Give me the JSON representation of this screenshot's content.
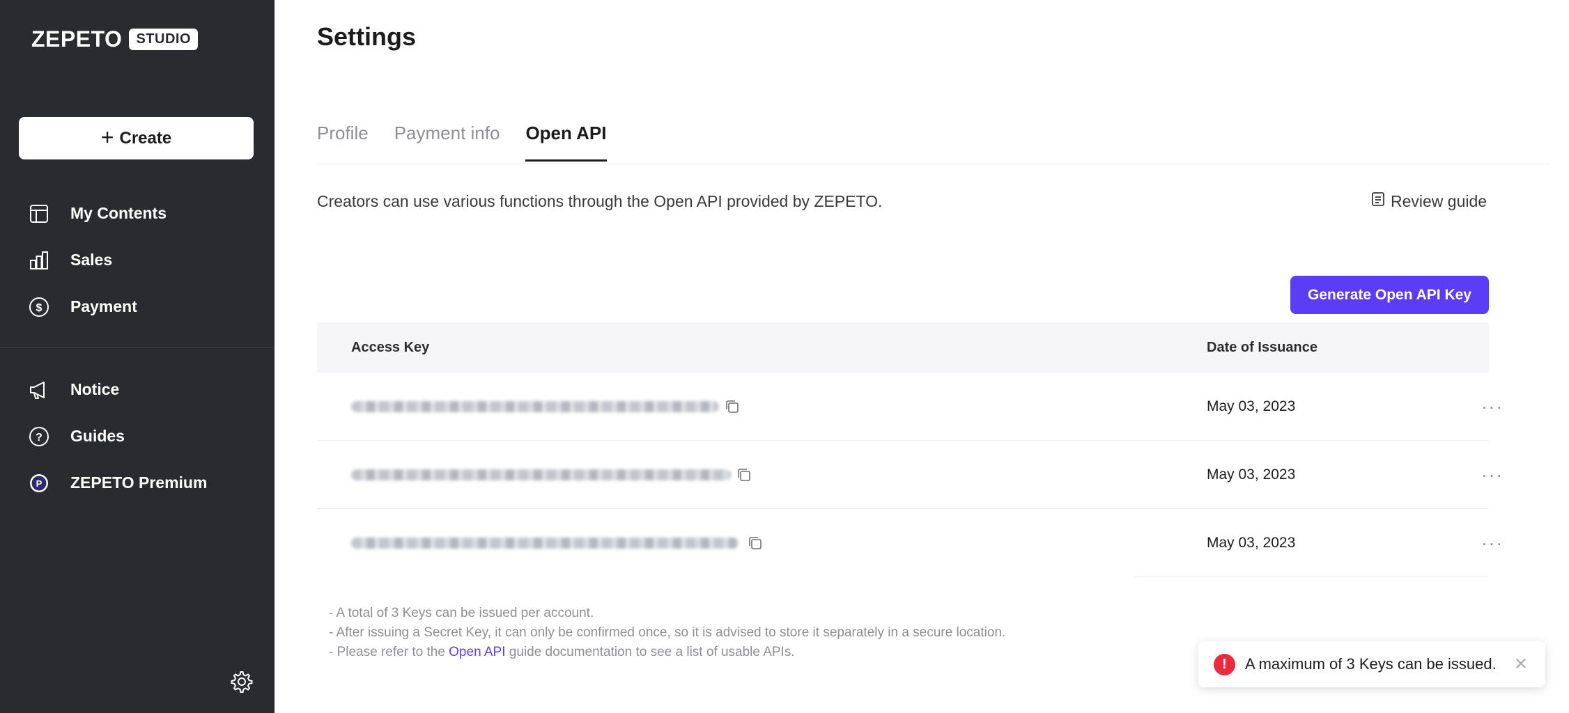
{
  "brand": {
    "name": "ZEPETO",
    "badge": "STUDIO"
  },
  "sidebar": {
    "create_label": "Create",
    "primary": [
      {
        "label": "My Contents",
        "icon": "layout-icon"
      },
      {
        "label": "Sales",
        "icon": "bar-chart-icon"
      },
      {
        "label": "Payment",
        "icon": "dollar-circle-icon"
      }
    ],
    "secondary": [
      {
        "label": "Notice",
        "icon": "megaphone-icon"
      },
      {
        "label": "Guides",
        "icon": "question-circle-icon"
      },
      {
        "label": "ZEPETO Premium",
        "icon": "premium-p-icon"
      }
    ],
    "settings_icon": "gear-icon"
  },
  "main": {
    "title": "Settings",
    "tabs": [
      {
        "label": "Profile",
        "active": false
      },
      {
        "label": "Payment info",
        "active": false
      },
      {
        "label": "Open API",
        "active": true
      }
    ],
    "description": "Creators can use various functions through the Open API provided by ZEPETO.",
    "review_guide": "Review guide",
    "generate_button": "Generate Open API Key",
    "table": {
      "headers": {
        "key": "Access Key",
        "date": "Date of Issuance"
      },
      "rows": [
        {
          "key_hidden": true,
          "date": "May 03, 2023",
          "more": "···"
        },
        {
          "key_hidden": true,
          "date": "May 03, 2023",
          "more": "···"
        },
        {
          "key_hidden": true,
          "date": "May 03, 2023",
          "more": "···"
        }
      ]
    },
    "notes": {
      "line1": "- A total of 3 Keys can be issued per account.",
      "line2": "- After issuing a Secret Key, it can only be confirmed once, so it is advised to store it separately in a secure location.",
      "line3_prefix": "- Please refer to the ",
      "line3_link": "Open API",
      "line3_suffix": " guide documentation to see a list of usable APIs."
    }
  },
  "toast": {
    "message": "A maximum of 3 Keys can be issued.",
    "close": "✕",
    "icon": "!"
  },
  "colors": {
    "sidebar_bg": "#2a2b2f",
    "accent": "#5b3df6",
    "error": "#ea2b3f"
  }
}
